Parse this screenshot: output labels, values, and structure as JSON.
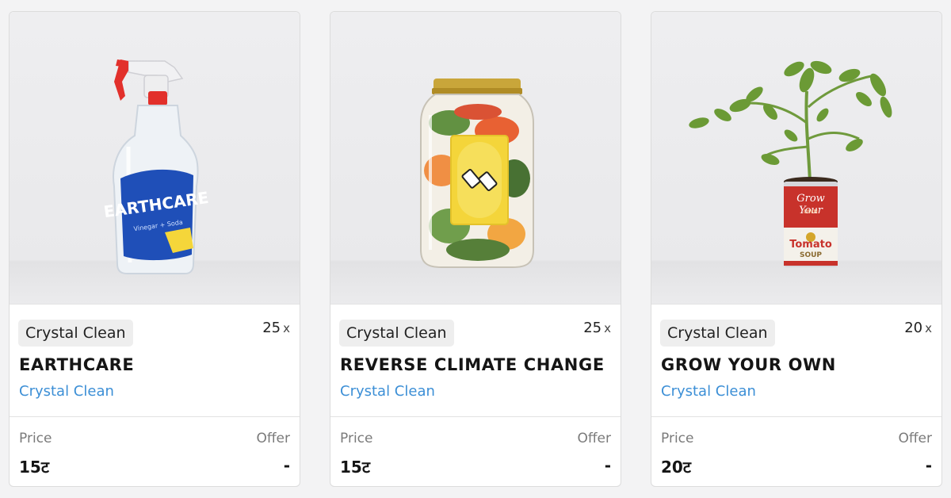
{
  "products": [
    {
      "tag": "Crystal Clean",
      "quantity": "25",
      "quantity_suffix": "x",
      "title": "EARTHCARE",
      "seller": "Crystal Clean",
      "price_label": "Price",
      "price": "15ट",
      "offer_label": "Offer",
      "offer": "-",
      "image": {
        "subject": "spray-bottle",
        "label_text": "EARTHCARE",
        "sub_text": "Vinegar + Soda"
      }
    },
    {
      "tag": "Crystal Clean",
      "quantity": "25",
      "quantity_suffix": "x",
      "title": "REVERSE CLIMATE CHANGE",
      "seller": "Crystal Clean",
      "price_label": "Price",
      "price": "15ट",
      "offer_label": "Offer",
      "offer": "-",
      "image": {
        "subject": "jar-with-reverse-card"
      }
    },
    {
      "tag": "Crystal Clean",
      "quantity": "20",
      "quantity_suffix": "x",
      "title": "GROW YOUR OWN",
      "seller": "Crystal Clean",
      "price_label": "Price",
      "price": "20ट",
      "offer_label": "Offer",
      "offer": "-",
      "image": {
        "subject": "plant-in-soup-can",
        "label_text": "Grow Your",
        "sub_text": "OWN",
        "can_text": "Tomato",
        "can_text2": "SOUP"
      }
    }
  ],
  "colors": {
    "accent_link": "#3c8fd6",
    "tag_bg": "#eeeeee",
    "card_border": "#dcdcdc"
  }
}
